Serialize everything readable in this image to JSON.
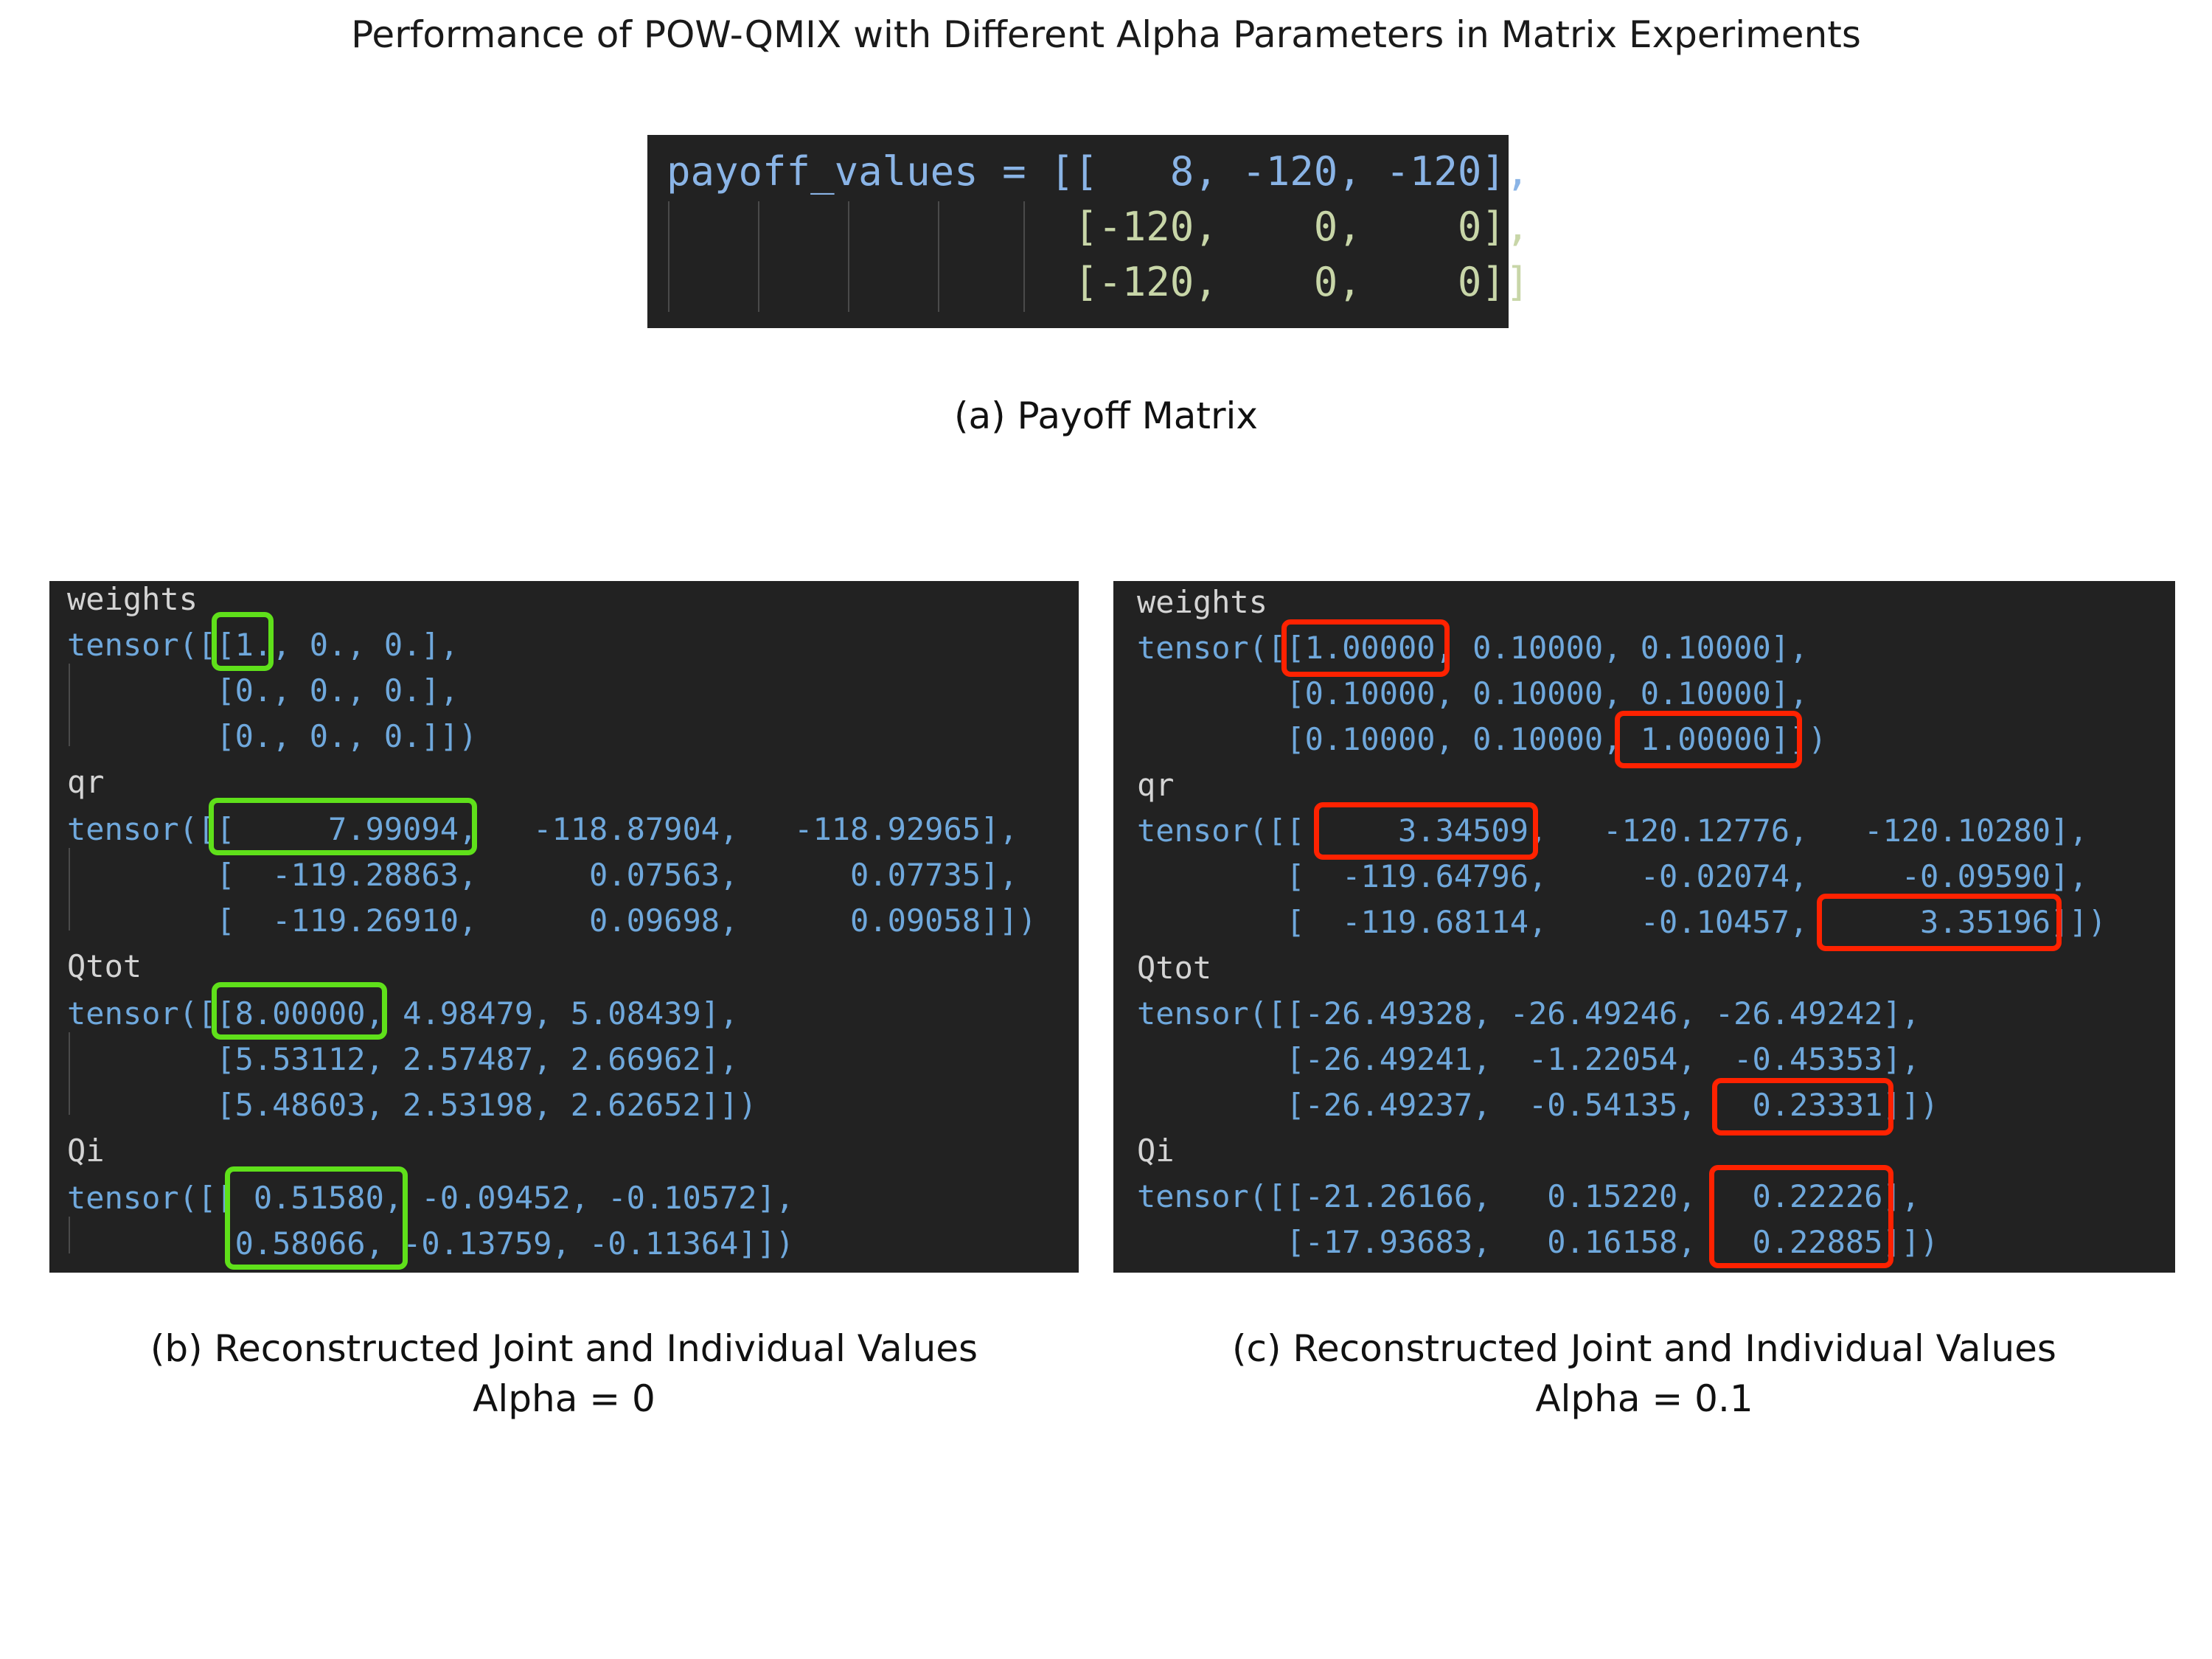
{
  "figure_title": "Performance of POW-QMIX with Different Alpha Parameters in Matrix Experiments",
  "panel_a": {
    "caption": "(a) Payoff Matrix",
    "lines": [
      "payoff_values = [[   8, -120, -120],",
      "                 [-120,    0,    0],",
      "                 [-120,    0,    0]]"
    ]
  },
  "panel_b": {
    "caption_line1": "(b) Reconstructed Joint and Individual Values",
    "caption_line2": "Alpha = 0",
    "lines": [
      "weights",
      "tensor([[1., 0., 0.],",
      "        [0., 0., 0.],",
      "        [0., 0., 0.]])",
      "qr",
      "tensor([[     7.99094,   -118.87904,   -118.92965],",
      "        [  -119.28863,      0.07563,      0.07735],",
      "        [  -119.26910,      0.09698,      0.09058]])",
      "Qtot",
      "tensor([[8.00000, 4.98479, 5.08439],",
      "        [5.53112, 2.57487, 2.66962],",
      "        [5.48603, 2.53198, 2.62652]])",
      "Qi",
      "tensor([[ 0.51580, -0.09452, -0.10572],",
      "         0.58066, -0.13759, -0.11364]])"
    ]
  },
  "panel_c": {
    "caption_line1": "(c) Reconstructed Joint and Individual Values",
    "caption_line2": "Alpha = 0.1",
    "lines": [
      "weights",
      "tensor([[1.00000, 0.10000, 0.10000],",
      "        [0.10000, 0.10000, 0.10000],",
      "        [0.10000, 0.10000, 1.00000]])",
      "qr",
      "tensor([[     3.34509,   -120.12776,   -120.10280],",
      "        [  -119.64796,     -0.02074,     -0.09590],",
      "        [  -119.68114,     -0.10457,      3.35196]])",
      "Qtot",
      "tensor([[-26.49328, -26.49246, -26.49242],",
      "        [-26.49241,  -1.22054,  -0.45353],",
      "        [-26.49237,  -0.54135,   0.23331]])",
      "Qi",
      "tensor([[-21.26166,   0.15220,   0.22226],",
      "        [-17.93683,   0.16158,   0.22885]])"
    ]
  }
}
